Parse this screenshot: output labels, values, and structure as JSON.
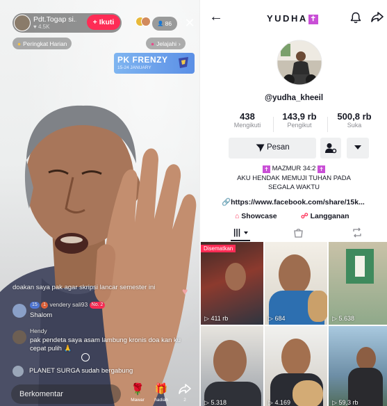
{
  "live": {
    "host": {
      "name": "Pdt.Togap si...",
      "likes": "♥ 4.5K",
      "follow_label": "+ Ikuti"
    },
    "viewer_count": "86",
    "close_label": "✕",
    "ranking_label": "Peringkat Harian",
    "explore_label": "Jelajahi",
    "pk_banner": {
      "title": "PK FRENZY",
      "subtitle": "15-24 JANUARY"
    },
    "comments": [
      {
        "user": "",
        "text": "doakan saya pak agar skripsi lancar semester ini"
      },
      {
        "user": "vendery sali93",
        "text": "Shalom",
        "badge1": "15",
        "badge2": "1",
        "badge3": "No. 2"
      },
      {
        "user": "Hendy",
        "text": "pak pendeta saya asam lambung kronis doa kan ku cepat pulih 🙏"
      },
      {
        "user": "",
        "text": "PLANET SURGA sudah bergabung"
      }
    ],
    "bottom": {
      "comment_placeholder": "Berkomentar",
      "rose_label": "Mawar",
      "gift_label": "hadiah",
      "share_count": "2"
    }
  },
  "profile": {
    "back_icon": "←",
    "title": "YUDHA",
    "title_suffix": "✝",
    "username": "@yudha_kheeil",
    "stats": [
      {
        "value": "438",
        "label": "Mengikuti"
      },
      {
        "value": "143,9 rb",
        "label": "Pengikut"
      },
      {
        "value": "500,8 rb",
        "label": "Suka"
      }
    ],
    "message_label": "Pesan",
    "bio_line1": "MAZMUR 34:2",
    "bio_line2": "AKU HENDAK MEMUJI TUHAN PADA",
    "bio_line3": "SEGALA WAKTU",
    "link": "https://www.facebook.com/share/15k...",
    "showcase_label": "Showcase",
    "subscription_label": "Langganan",
    "pinned_label": "Disematkan",
    "videos": [
      {
        "views": "411 rb"
      },
      {
        "views": "684"
      },
      {
        "views": "5.638"
      },
      {
        "views": "5.318"
      },
      {
        "views": "4.169"
      },
      {
        "views": "59,3 rb"
      }
    ]
  },
  "colors": {
    "accent": "#fe2c55",
    "purple": "#c94fd6"
  }
}
